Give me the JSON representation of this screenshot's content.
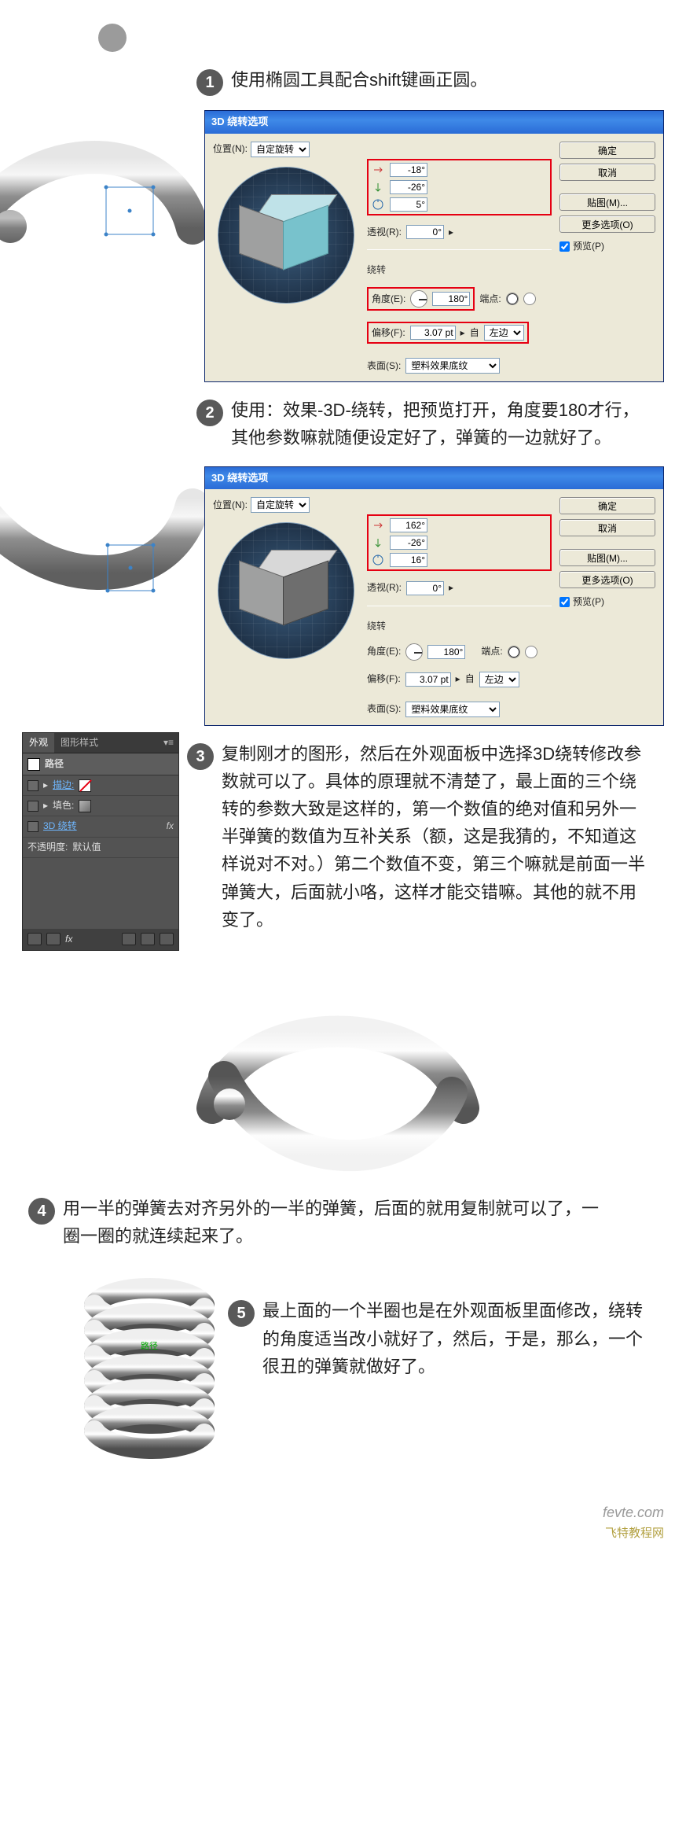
{
  "step1": {
    "num": "1",
    "text": "使用椭圆工具配合shift键画正圆。"
  },
  "step2": {
    "num": "2",
    "text": "使用：效果-3D-绕转，把预览打开，角度要180才行，其他参数嘛就随便设定好了，弹簧的一边就好了。"
  },
  "step3": {
    "num": "3",
    "text": "复制刚才的图形，然后在外观面板中选择3D绕转修改参数就可以了。具体的原理就不清楚了，最上面的三个绕转的参数大致是这样的，第一个数值的绝对值和另外一半弹簧的数值为互补关系（额，这是我猜的，不知道这样说对不对。）第二个数值不变，第三个嘛就是前面一半弹簧大，后面就小咯，这样才能交错嘛。其他的就不用变了。"
  },
  "step4": {
    "num": "4",
    "text": "用一半的弹簧去对齐另外的一半的弹簧，后面的就用复制就可以了，一圈一圈的就连续起来了。"
  },
  "step5": {
    "num": "5",
    "text": "最上面的一个半圈也是在外观面板里面修改，绕转的角度适当改小就好了，然后，于是，那么，一个很丑的弹簧就做好了。"
  },
  "dialog_title": "3D 绕转选项",
  "labels": {
    "position": "位置(N):",
    "custom": "自定旋转",
    "persp": "透视(R):",
    "section": "绕转",
    "angle": "角度(E):",
    "cap": "端点:",
    "offset": "偏移(F):",
    "from": "自",
    "left": "左边",
    "surface": "表面(S):",
    "surface_val": "塑料效果底纹",
    "ok": "确定",
    "cancel": "取消",
    "map": "贴图(M)...",
    "more": "更多选项(O)",
    "preview": "预览(P)"
  },
  "dlg1": {
    "rx": "-18°",
    "ry": "-26°",
    "rz": "5°",
    "persp": "0°",
    "angle": "180°",
    "offset": "3.07 pt"
  },
  "dlg2": {
    "rx": "162°",
    "ry": "-26°",
    "rz": "16°",
    "persp": "0°",
    "angle": "180°",
    "offset": "3.07 pt"
  },
  "appearance": {
    "tab1": "外观",
    "tab2": "图形样式",
    "title": "路径",
    "rows": {
      "stroke": "描边:",
      "fill": "填色:",
      "revolve": "3D 绕转",
      "opacity": "不透明度:",
      "opacity_val": "默认值"
    },
    "fx": "fx"
  },
  "coil_label": "路径",
  "watermark": {
    "main": "fevte.com",
    "sub": "飞特教程网"
  }
}
